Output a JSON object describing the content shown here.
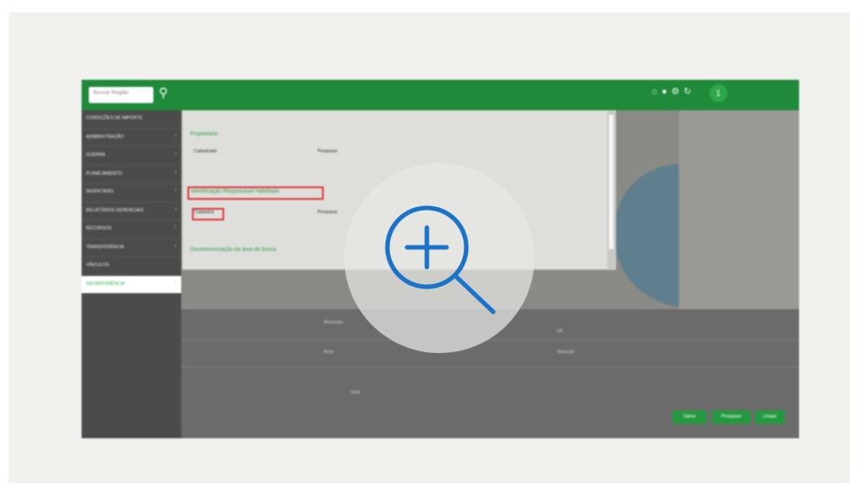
{
  "topbar": {
    "search_placeholder": "Buscar Região",
    "search_icon": "search-icon",
    "icons": [
      "home-icon",
      "user-icon",
      "settings-icon",
      "sync-icon"
    ],
    "user_badge": "1"
  },
  "sidebar": {
    "items": [
      {
        "label": "CONDIÇÕES DE IMPORTE",
        "active": false
      },
      {
        "label": "ADMINISTRAÇÃO",
        "active": false
      },
      {
        "label": "GUERRA",
        "active": false
      },
      {
        "label": "PLANEJAMENTO",
        "active": false
      },
      {
        "label": "INVENTÁRIO",
        "active": false
      },
      {
        "label": "RELATÓRIOS GERENCIAIS",
        "active": false
      },
      {
        "label": "RECURSOS",
        "active": false
      },
      {
        "label": "TRANSFERÊNCIA",
        "active": false
      },
      {
        "label": "VÍNCULOS",
        "active": false
      },
      {
        "label": "GEOREFERÊNCIA",
        "active": true
      }
    ]
  },
  "panel": {
    "section1": "Proprietário",
    "field1_value": "Cadastrado",
    "field1_right": "Pesquisar",
    "section2": "Identificação Responsável Habilitado",
    "field2_value": "Cadastrar",
    "field2_right": "Pesquisar",
    "section3": "Georeferenciação da área de busca"
  },
  "bottom": {
    "label1": "Município",
    "label2": "Área",
    "label3": "UF",
    "label4": "Situação",
    "label5": "Data",
    "buttons": [
      "Salvar",
      "Pesquisar",
      "Limpar"
    ]
  },
  "overlay": {
    "zoom_icon": "zoom-in-icon",
    "accent": "#1a73c9"
  },
  "colors": {
    "brand_green": "#1f8a3a",
    "active_green": "#2bb34f",
    "highlight_red": "#e23b3b"
  }
}
